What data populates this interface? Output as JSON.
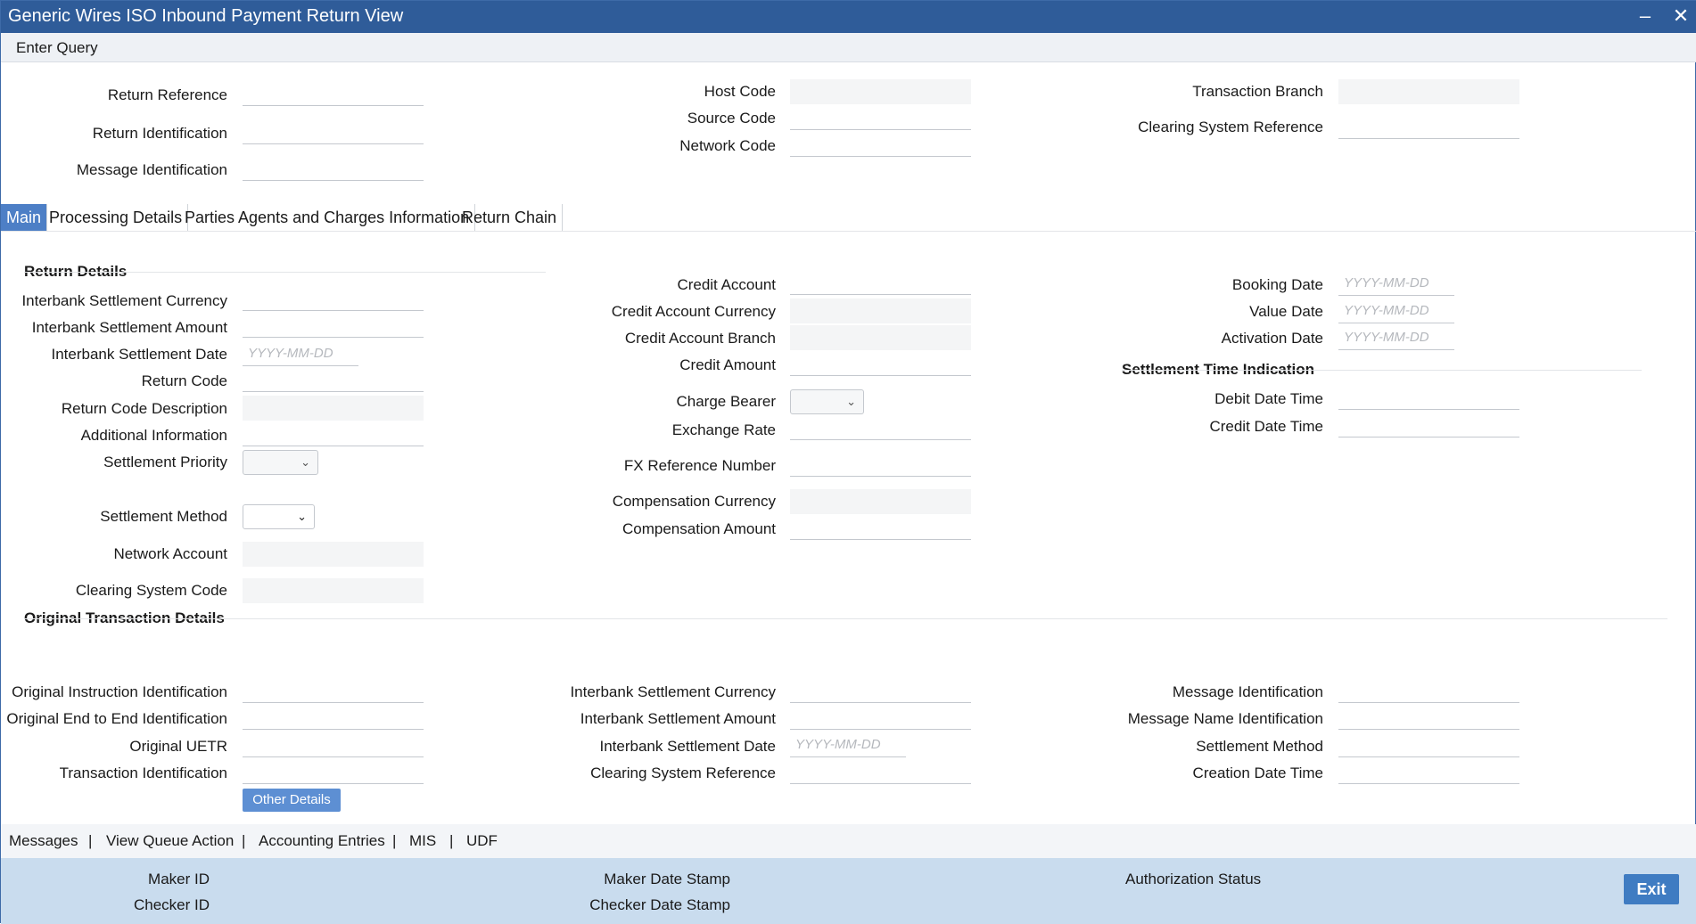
{
  "window": {
    "title": "Generic Wires ISO Inbound Payment Return View",
    "minimize_glyph": "‒",
    "close_glyph": "✕"
  },
  "toolbar": {
    "enter_query": "Enter Query"
  },
  "header": {
    "return_reference": "Return Reference",
    "return_identification": "Return Identification",
    "message_identification": "Message Identification",
    "host_code": "Host Code",
    "source_code": "Source Code",
    "network_code": "Network Code",
    "transaction_branch": "Transaction Branch",
    "clearing_system_reference": "Clearing System Reference"
  },
  "tabs": [
    "Main",
    "Processing Details",
    "Parties Agents and Charges Information",
    "Return Chain"
  ],
  "date_placeholder": "YYYY-MM-DD",
  "return_details": {
    "title": "Return Details",
    "interbank_settlement_currency": "Interbank Settlement Currency",
    "interbank_settlement_amount": "Interbank Settlement Amount",
    "interbank_settlement_date": "Interbank Settlement Date",
    "return_code": "Return Code",
    "return_code_description": "Return Code Description",
    "additional_information": "Additional Information",
    "settlement_priority": "Settlement Priority",
    "settlement_method": "Settlement Method",
    "network_account": "Network Account",
    "clearing_system_code": "Clearing System Code"
  },
  "credit": {
    "credit_account": "Credit Account",
    "credit_account_currency": "Credit Account Currency",
    "credit_account_branch": "Credit Account Branch",
    "credit_amount": "Credit Amount",
    "charge_bearer": "Charge Bearer",
    "exchange_rate": "Exchange Rate",
    "fx_reference_number": "FX Reference Number",
    "compensation_currency": "Compensation Currency",
    "compensation_amount": "Compensation Amount"
  },
  "dates": {
    "booking_date": "Booking Date",
    "value_date": "Value Date",
    "activation_date": "Activation Date",
    "settlement_time_indication": "Settlement Time Indication",
    "debit_date_time": "Debit Date Time",
    "credit_date_time": "Credit Date Time"
  },
  "original": {
    "title": "Original Transaction Details",
    "original_instruction_identification": "Original Instruction Identification",
    "original_end_to_end_identification": "Original End to End Identification",
    "original_uetr": "Original UETR",
    "transaction_identification": "Transaction Identification",
    "interbank_settlement_currency": "Interbank Settlement Currency",
    "interbank_settlement_amount": "Interbank Settlement Amount",
    "interbank_settlement_date": "Interbank Settlement Date",
    "clearing_system_reference": "Clearing System Reference",
    "message_identification": "Message Identification",
    "message_name_identification": "Message Name Identification",
    "settlement_method": "Settlement Method",
    "creation_date_time": "Creation Date Time",
    "other_details_button": "Other Details"
  },
  "bottom_links": [
    "Messages",
    "View Queue Action",
    "Accounting Entries",
    "MIS",
    "UDF"
  ],
  "separator": "|",
  "footer": {
    "maker_id": "Maker ID",
    "checker_id": "Checker ID",
    "maker_date_stamp": "Maker Date Stamp",
    "checker_date_stamp": "Checker Date Stamp",
    "authorization_status": "Authorization Status",
    "exit_button": "Exit"
  }
}
